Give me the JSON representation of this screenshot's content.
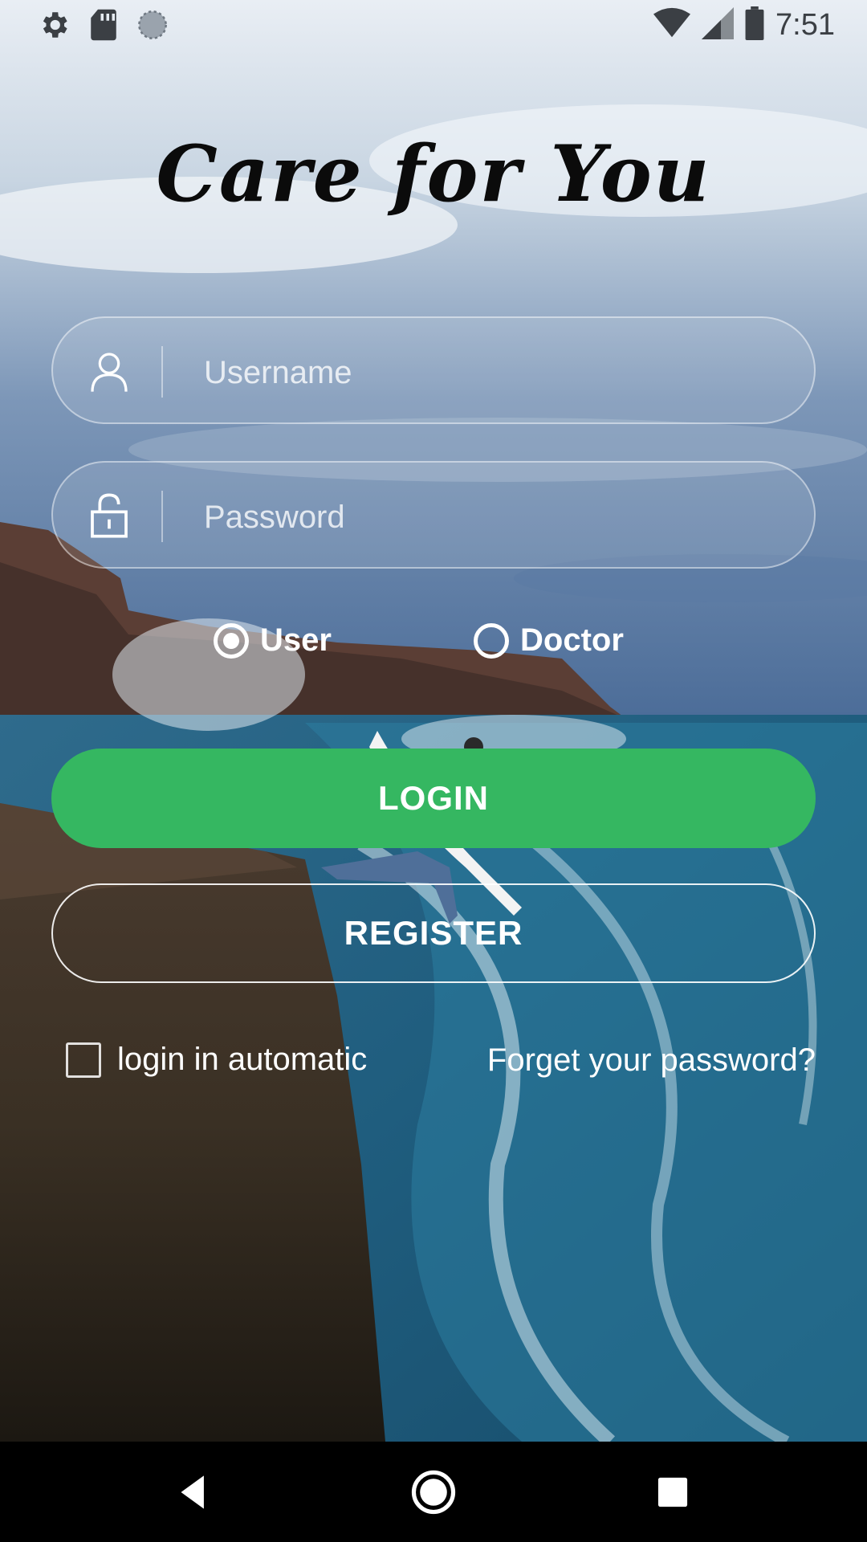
{
  "status_bar": {
    "time": "7:51",
    "left_icons": [
      "settings-icon",
      "sd-card-icon",
      "sync-icon"
    ],
    "right_icons": [
      "wifi-icon",
      "signal-icon",
      "battery-icon"
    ]
  },
  "app": {
    "title": "Care for You"
  },
  "form": {
    "username": {
      "placeholder": "Username",
      "value": "",
      "icon": "user-icon"
    },
    "password": {
      "placeholder": "Password",
      "value": "",
      "icon": "lock-icon"
    },
    "role_options": [
      {
        "label": "User",
        "selected": true
      },
      {
        "label": "Doctor",
        "selected": false
      }
    ],
    "login_label": "LOGIN",
    "register_label": "REGISTER",
    "auto_login_label": "login in automatic",
    "auto_login_checked": false,
    "forgot_label": "Forget your password?"
  },
  "colors": {
    "login_button": "#35b761",
    "text": "#ffffff"
  },
  "nav_bar": {
    "buttons": [
      "back-icon",
      "home-icon",
      "recents-icon"
    ]
  }
}
